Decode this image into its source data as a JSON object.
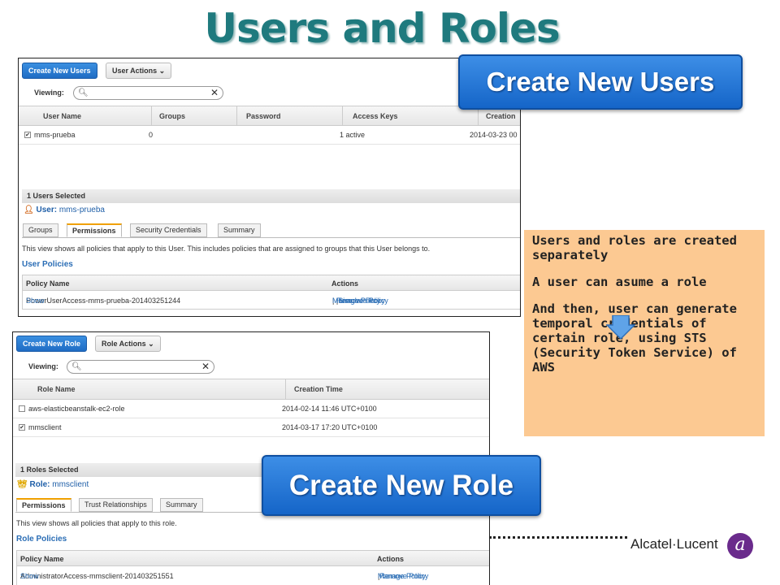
{
  "slide": {
    "title": "Users and Roles",
    "callout": {
      "p1": "Users and roles are created separately",
      "p2": "A user can asume a role",
      "p3": "And then,  user can generate temporal credentials of certain role, using STS (Security Token Service) of AWS"
    },
    "zoom_users": "Create New Users",
    "zoom_role": "Create New Role",
    "logo": "Alcatel·Lucent",
    "logo_mark": "a"
  },
  "users": {
    "create_btn": "Create New Users",
    "actions_btn": "User Actions ⌄",
    "viewing": "Viewing:",
    "columns": [
      "User Name",
      "Groups",
      "Password",
      "Access Keys",
      "Creation"
    ],
    "row": {
      "name": "mms-prueba",
      "groups": "0",
      "password": "",
      "keys": "1 active",
      "created": "2014-03-23 00"
    },
    "selected": "1 Users Selected",
    "user_label": "User:",
    "user_name": "mms-prueba",
    "tabs": [
      "Groups",
      "Permissions",
      "Security Credentials",
      "Summary"
    ],
    "note": "This view shows all policies that apply to this User. This includes policies that are assigned to groups that this User belongs to.",
    "policies_title": "User Policies",
    "policy_cols": [
      "Policy Name",
      "Actions"
    ],
    "policy_name": "PowerUserAccess-mms-prueba-201403251244",
    "show": "Show",
    "actions": [
      "Manage Policy",
      "Remove Policy",
      "Simulate Policy"
    ]
  },
  "roles": {
    "create_btn": "Create New Role",
    "actions_btn": "Role Actions ⌄",
    "viewing": "Viewing:",
    "columns": [
      "Role Name",
      "Creation Time"
    ],
    "rows": [
      {
        "name": "aws-elasticbeanstalk-ec2-role",
        "created": "2014-02-14 11:46 UTC+0100",
        "checked": false
      },
      {
        "name": "mmsclient",
        "created": "2014-03-17 17:20 UTC+0100",
        "checked": true
      }
    ],
    "selected": "1 Roles Selected",
    "role_label": "Role:",
    "role_name": "mmsclient",
    "tabs": [
      "Permissions",
      "Trust Relationships",
      "Summary"
    ],
    "note": "This view shows all policies that apply to this role.",
    "policies_title": "Role Policies",
    "policy_cols": [
      "Policy Name",
      "Actions"
    ],
    "policy_name": "AdministratorAccess-mmsclient-201403251551",
    "show": "Show",
    "actions": [
      "Manage Policy",
      "Remove Policy"
    ]
  }
}
